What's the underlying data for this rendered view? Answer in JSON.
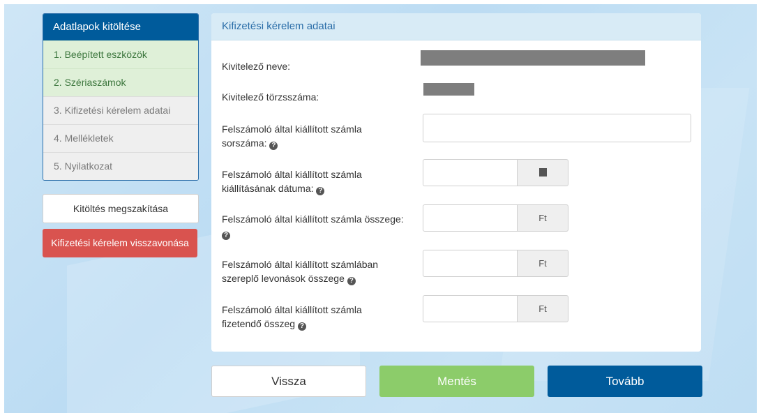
{
  "sidebar": {
    "title": "Adatlapok kitöltése",
    "steps": [
      {
        "label": "1. Beépített eszközök",
        "status": "done"
      },
      {
        "label": "2. Szériaszámok",
        "status": "done"
      },
      {
        "label": "3. Kifizetési kérelem adatai",
        "status": "pending"
      },
      {
        "label": "4. Mellékletek",
        "status": "pending"
      },
      {
        "label": "5. Nyilatkozat",
        "status": "pending"
      }
    ],
    "abort_label": "Kitöltés megszakítása",
    "withdraw_label": "Kifizetési kérelem visszavonása"
  },
  "panel": {
    "title": "Kifizetési kérelem adatai",
    "contractor_name_label": "Kivitelező neve:",
    "contractor_id_label": "Kivitelező törzsszáma:",
    "invoice_number_label_1": "Felszámoló által kiállított számla",
    "invoice_number_label_2": "sorszáma:",
    "invoice_date_label_1": "Felszámoló által kiállított számla",
    "invoice_date_label_2": "kiállításának dátuma:",
    "invoice_amount_label_1": "Felszámoló által kiállított számla összege:",
    "deductions_label_1": "Felszámoló által kiállított számlában",
    "deductions_label_2": "szereplő levonások összege",
    "payable_label_1": "Felszámoló által kiállított számla",
    "payable_label_2": "fizetendő összeg",
    "currency": "Ft",
    "help_glyph": "?"
  },
  "footer": {
    "back_label": "Vissza",
    "save_label": "Mentés",
    "next_label": "Tovább"
  },
  "colors": {
    "primary": "#005b9b",
    "success": "#8ccc6a",
    "danger": "#d9534f",
    "step_done_bg": "#dff0d8"
  }
}
